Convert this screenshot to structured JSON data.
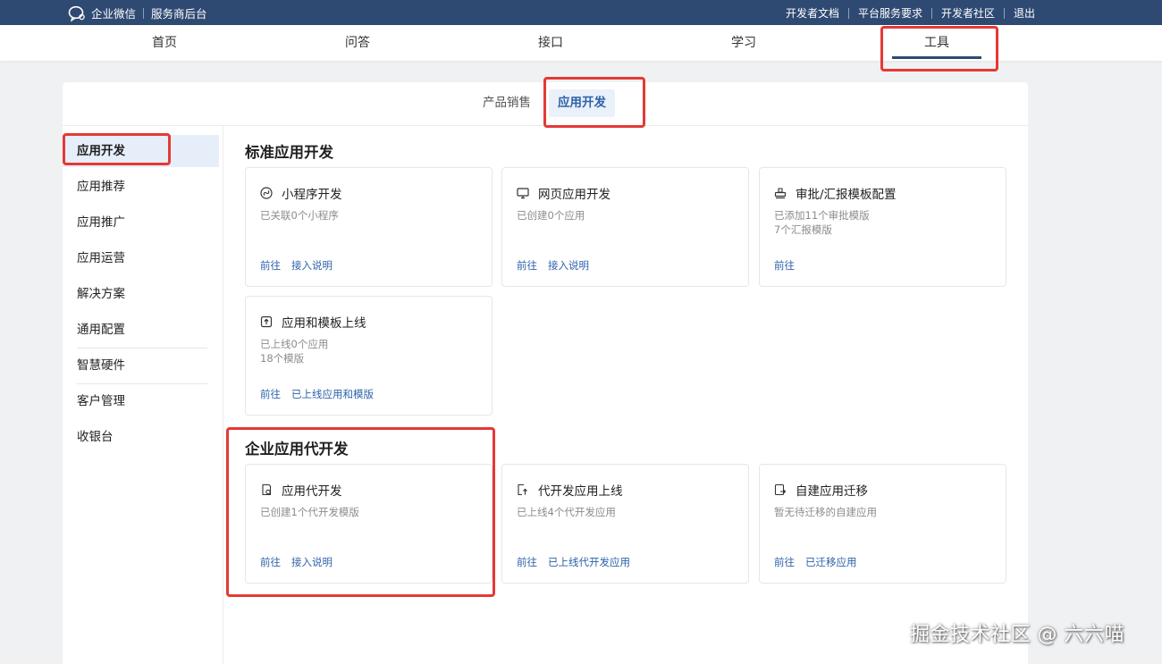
{
  "topbar": {
    "brand": "企业微信",
    "subtitle": "服务商后台",
    "links": [
      "开发者文档",
      "平台服务要求",
      "开发者社区",
      "退出"
    ]
  },
  "nav": {
    "items": [
      "首页",
      "问答",
      "接口",
      "学习",
      "工具"
    ],
    "active": "工具"
  },
  "tabs": {
    "items": [
      "产品销售",
      "应用开发"
    ],
    "active": "应用开发"
  },
  "sidebar": {
    "items": [
      "应用开发",
      "应用推荐",
      "应用推广",
      "应用运营",
      "解决方案",
      "通用配置",
      "智慧硬件",
      "客户管理",
      "收银台"
    ],
    "active": "应用开发"
  },
  "sections": [
    {
      "title": "标准应用开发",
      "cards": [
        {
          "icon": "mini-program-icon",
          "title": "小程序开发",
          "desc": [
            "已关联0个小程序"
          ],
          "links": [
            "前往",
            "接入说明"
          ]
        },
        {
          "icon": "monitor-icon",
          "title": "网页应用开发",
          "desc": [
            "已创建0个应用"
          ],
          "links": [
            "前往",
            "接入说明"
          ]
        },
        {
          "icon": "stamp-icon",
          "title": "审批/汇报模板配置",
          "desc": [
            "已添加11个审批模版",
            "7个汇报模版"
          ],
          "links": [
            "前往"
          ]
        },
        {
          "icon": "upload-icon",
          "title": "应用和模板上线",
          "desc": [
            "已上线0个应用",
            "18个模版"
          ],
          "links": [
            "前往",
            "已上线应用和模版"
          ]
        }
      ]
    },
    {
      "title": "企业应用代开发",
      "cards": [
        {
          "icon": "doc-settings-icon",
          "title": "应用代开发",
          "desc": [
            "已创建1个代开发模版"
          ],
          "links": [
            "前往",
            "接入说明"
          ]
        },
        {
          "icon": "launch-icon",
          "title": "代开发应用上线",
          "desc": [
            "已上线4个代开发应用"
          ],
          "links": [
            "前往",
            "已上线代开发应用"
          ]
        },
        {
          "icon": "migrate-icon",
          "title": "自建应用迁移",
          "desc": [
            "暂无待迁移的自建应用"
          ],
          "links": [
            "前往",
            "已迁移应用"
          ]
        }
      ]
    }
  ],
  "watermark": "掘金技术社区 @ 六六喵",
  "colors": {
    "topbar": "#2f4a72",
    "link": "#2d62a8",
    "highlight": "#e53935",
    "active_bg": "#e6eefa"
  }
}
